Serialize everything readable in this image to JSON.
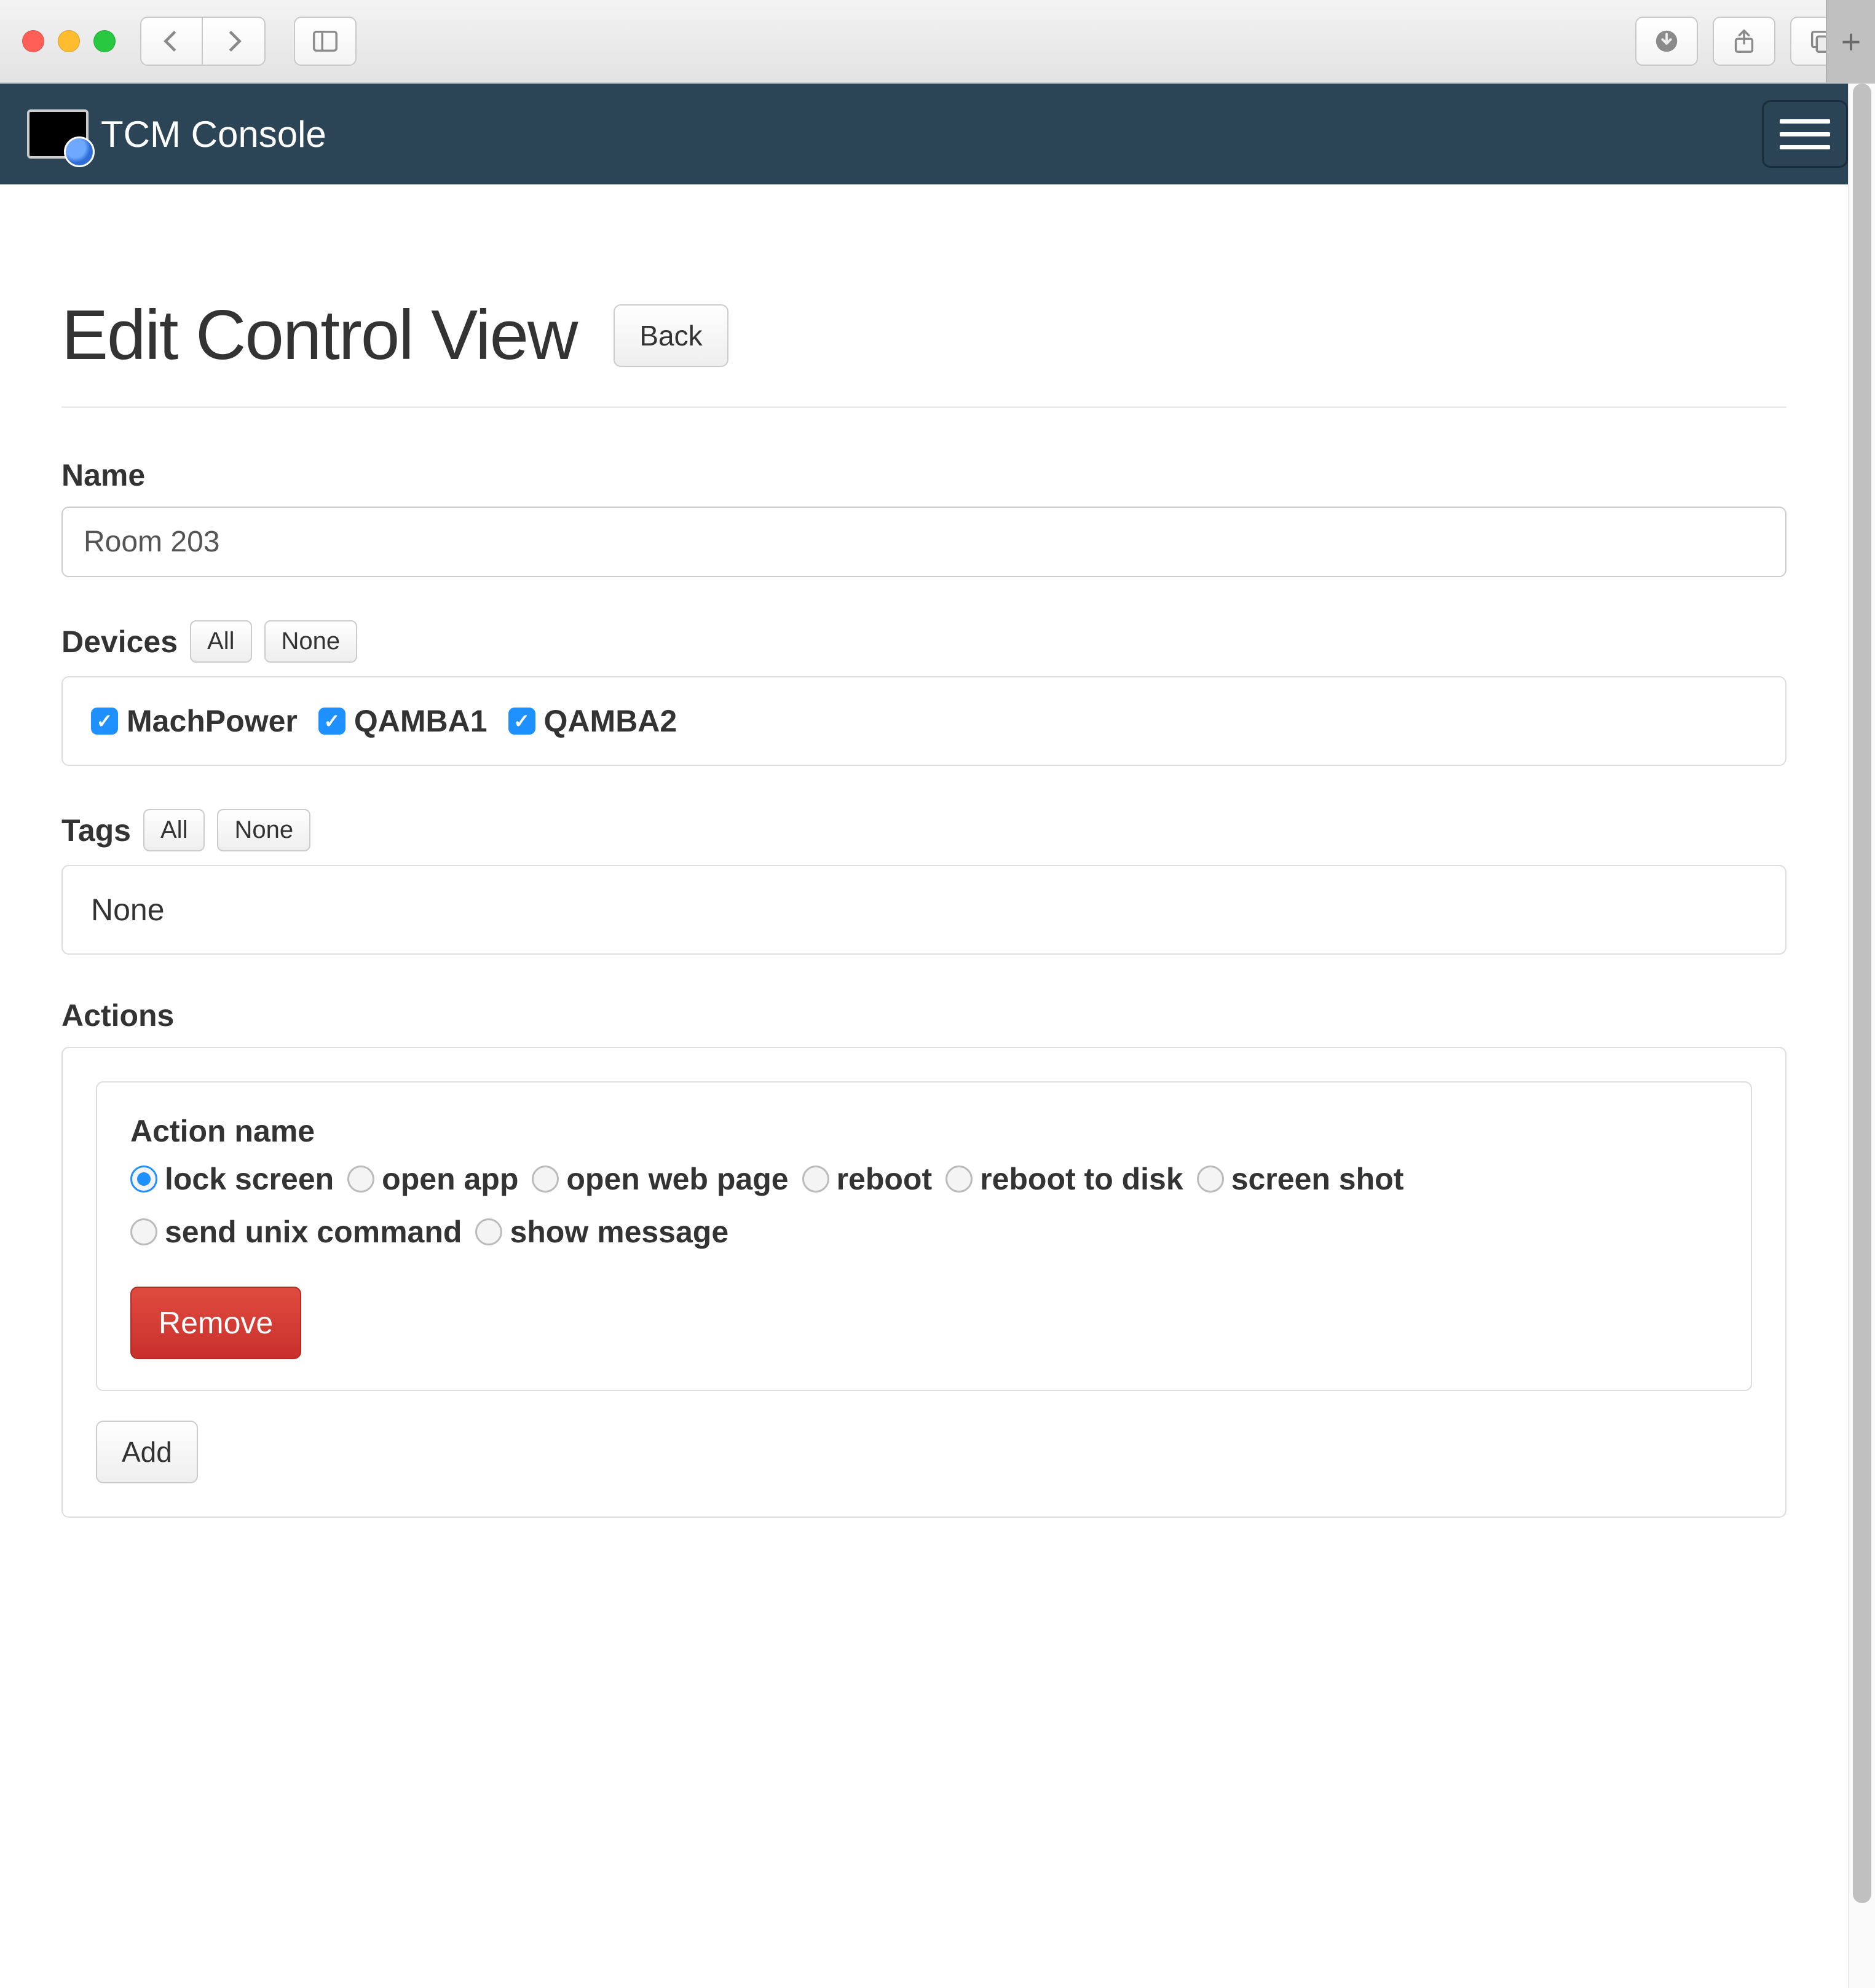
{
  "nav": {
    "title": "TCM Console"
  },
  "header": {
    "title": "Edit Control View",
    "back": "Back"
  },
  "form": {
    "name_label": "Name",
    "name_value": "Room 203",
    "devices_label": "Devices",
    "all_btn": "All",
    "none_btn": "None",
    "devices": [
      {
        "label": "MachPower",
        "checked": true
      },
      {
        "label": "QAMBA1",
        "checked": true
      },
      {
        "label": "QAMBA2",
        "checked": true
      }
    ],
    "tags_label": "Tags",
    "tags_content": "None",
    "actions_label": "Actions",
    "action_name_label": "Action name",
    "action_options": [
      {
        "label": "lock screen",
        "selected": true
      },
      {
        "label": "open app",
        "selected": false
      },
      {
        "label": "open web page",
        "selected": false
      },
      {
        "label": "reboot",
        "selected": false
      },
      {
        "label": "reboot to disk",
        "selected": false
      },
      {
        "label": "screen shot",
        "selected": false
      },
      {
        "label": "send unix command",
        "selected": false
      },
      {
        "label": "show message",
        "selected": false
      }
    ],
    "remove_btn": "Remove",
    "add_btn": "Add"
  }
}
